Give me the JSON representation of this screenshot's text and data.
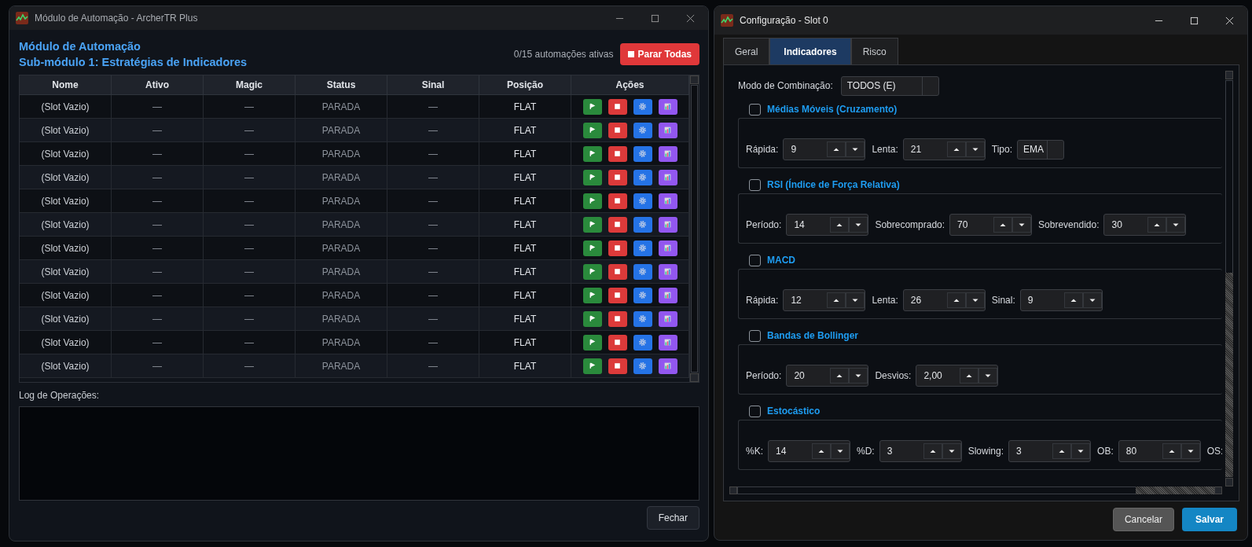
{
  "automation_window": {
    "title": "Módulo de Automação - ArcherTR Plus",
    "heading": "Módulo de Automação",
    "subheading": "Sub-módulo 1: Estratégias de Indicadores",
    "active_count": "0/15 automações ativas",
    "stop_all_button": "Parar Todas",
    "table": {
      "columns": [
        "Nome",
        "Ativo",
        "Magic",
        "Status",
        "Sinal",
        "Posição",
        "Ações"
      ],
      "rows": [
        {
          "name": "(Slot Vazio)",
          "asset": "—",
          "magic": "—",
          "status": "PARADA",
          "signal": "—",
          "position": "FLAT"
        },
        {
          "name": "(Slot Vazio)",
          "asset": "—",
          "magic": "—",
          "status": "PARADA",
          "signal": "—",
          "position": "FLAT"
        },
        {
          "name": "(Slot Vazio)",
          "asset": "—",
          "magic": "—",
          "status": "PARADA",
          "signal": "—",
          "position": "FLAT"
        },
        {
          "name": "(Slot Vazio)",
          "asset": "—",
          "magic": "—",
          "status": "PARADA",
          "signal": "—",
          "position": "FLAT"
        },
        {
          "name": "(Slot Vazio)",
          "asset": "—",
          "magic": "—",
          "status": "PARADA",
          "signal": "—",
          "position": "FLAT"
        },
        {
          "name": "(Slot Vazio)",
          "asset": "—",
          "magic": "—",
          "status": "PARADA",
          "signal": "—",
          "position": "FLAT"
        },
        {
          "name": "(Slot Vazio)",
          "asset": "—",
          "magic": "—",
          "status": "PARADA",
          "signal": "—",
          "position": "FLAT"
        },
        {
          "name": "(Slot Vazio)",
          "asset": "—",
          "magic": "—",
          "status": "PARADA",
          "signal": "—",
          "position": "FLAT"
        },
        {
          "name": "(Slot Vazio)",
          "asset": "—",
          "magic": "—",
          "status": "PARADA",
          "signal": "—",
          "position": "FLAT"
        },
        {
          "name": "(Slot Vazio)",
          "asset": "—",
          "magic": "—",
          "status": "PARADA",
          "signal": "—",
          "position": "FLAT"
        },
        {
          "name": "(Slot Vazio)",
          "asset": "—",
          "magic": "—",
          "status": "PARADA",
          "signal": "—",
          "position": "FLAT"
        },
        {
          "name": "(Slot Vazio)",
          "asset": "—",
          "magic": "—",
          "status": "PARADA",
          "signal": "—",
          "position": "FLAT"
        }
      ]
    },
    "log_label": "Log de Operações:",
    "close_button": "Fechar"
  },
  "config_window": {
    "title": "Configuração - Slot 0",
    "tabs": [
      {
        "label": "Geral",
        "selected": false
      },
      {
        "label": "Indicadores",
        "selected": true
      },
      {
        "label": "Risco",
        "selected": false
      }
    ],
    "combination_mode": {
      "label": "Modo de Combinação:",
      "value": "TODOS (E)"
    },
    "indicators": [
      {
        "title": "Médias Móveis (Cruzamento)",
        "checked": false,
        "fields": [
          {
            "kind": "spin",
            "label": "Rápida:",
            "value": "9"
          },
          {
            "kind": "spin",
            "label": "Lenta:",
            "value": "21"
          },
          {
            "kind": "combo",
            "label": "Tipo:",
            "value": "EMA"
          }
        ]
      },
      {
        "title": "RSI (Índice de Força Relativa)",
        "checked": false,
        "fields": [
          {
            "kind": "spin",
            "label": "Período:",
            "value": "14"
          },
          {
            "kind": "spin",
            "label": "Sobrecomprado:",
            "value": "70"
          },
          {
            "kind": "spin",
            "label": "Sobrevendido:",
            "value": "30"
          }
        ]
      },
      {
        "title": "MACD",
        "checked": false,
        "fields": [
          {
            "kind": "spin",
            "label": "Rápida:",
            "value": "12"
          },
          {
            "kind": "spin",
            "label": "Lenta:",
            "value": "26"
          },
          {
            "kind": "spin",
            "label": "Sinal:",
            "value": "9"
          }
        ]
      },
      {
        "title": "Bandas de Bollinger",
        "checked": false,
        "fields": [
          {
            "kind": "spin",
            "label": "Período:",
            "value": "20"
          },
          {
            "kind": "spin",
            "label": "Desvios:",
            "value": "2,00"
          }
        ]
      },
      {
        "title": "Estocástico",
        "checked": false,
        "fields": [
          {
            "kind": "spin",
            "label": "%K:",
            "value": "14"
          },
          {
            "kind": "spin",
            "label": "%D:",
            "value": "3"
          },
          {
            "kind": "spin",
            "label": "Slowing:",
            "value": "3"
          },
          {
            "kind": "spin",
            "label": "OB:",
            "value": "80"
          },
          {
            "kind": "label",
            "label": "OS:"
          }
        ]
      }
    ],
    "buttons": [
      {
        "label": "Cancelar",
        "kind": "secondary"
      },
      {
        "label": "Salvar",
        "kind": "primary"
      }
    ]
  }
}
